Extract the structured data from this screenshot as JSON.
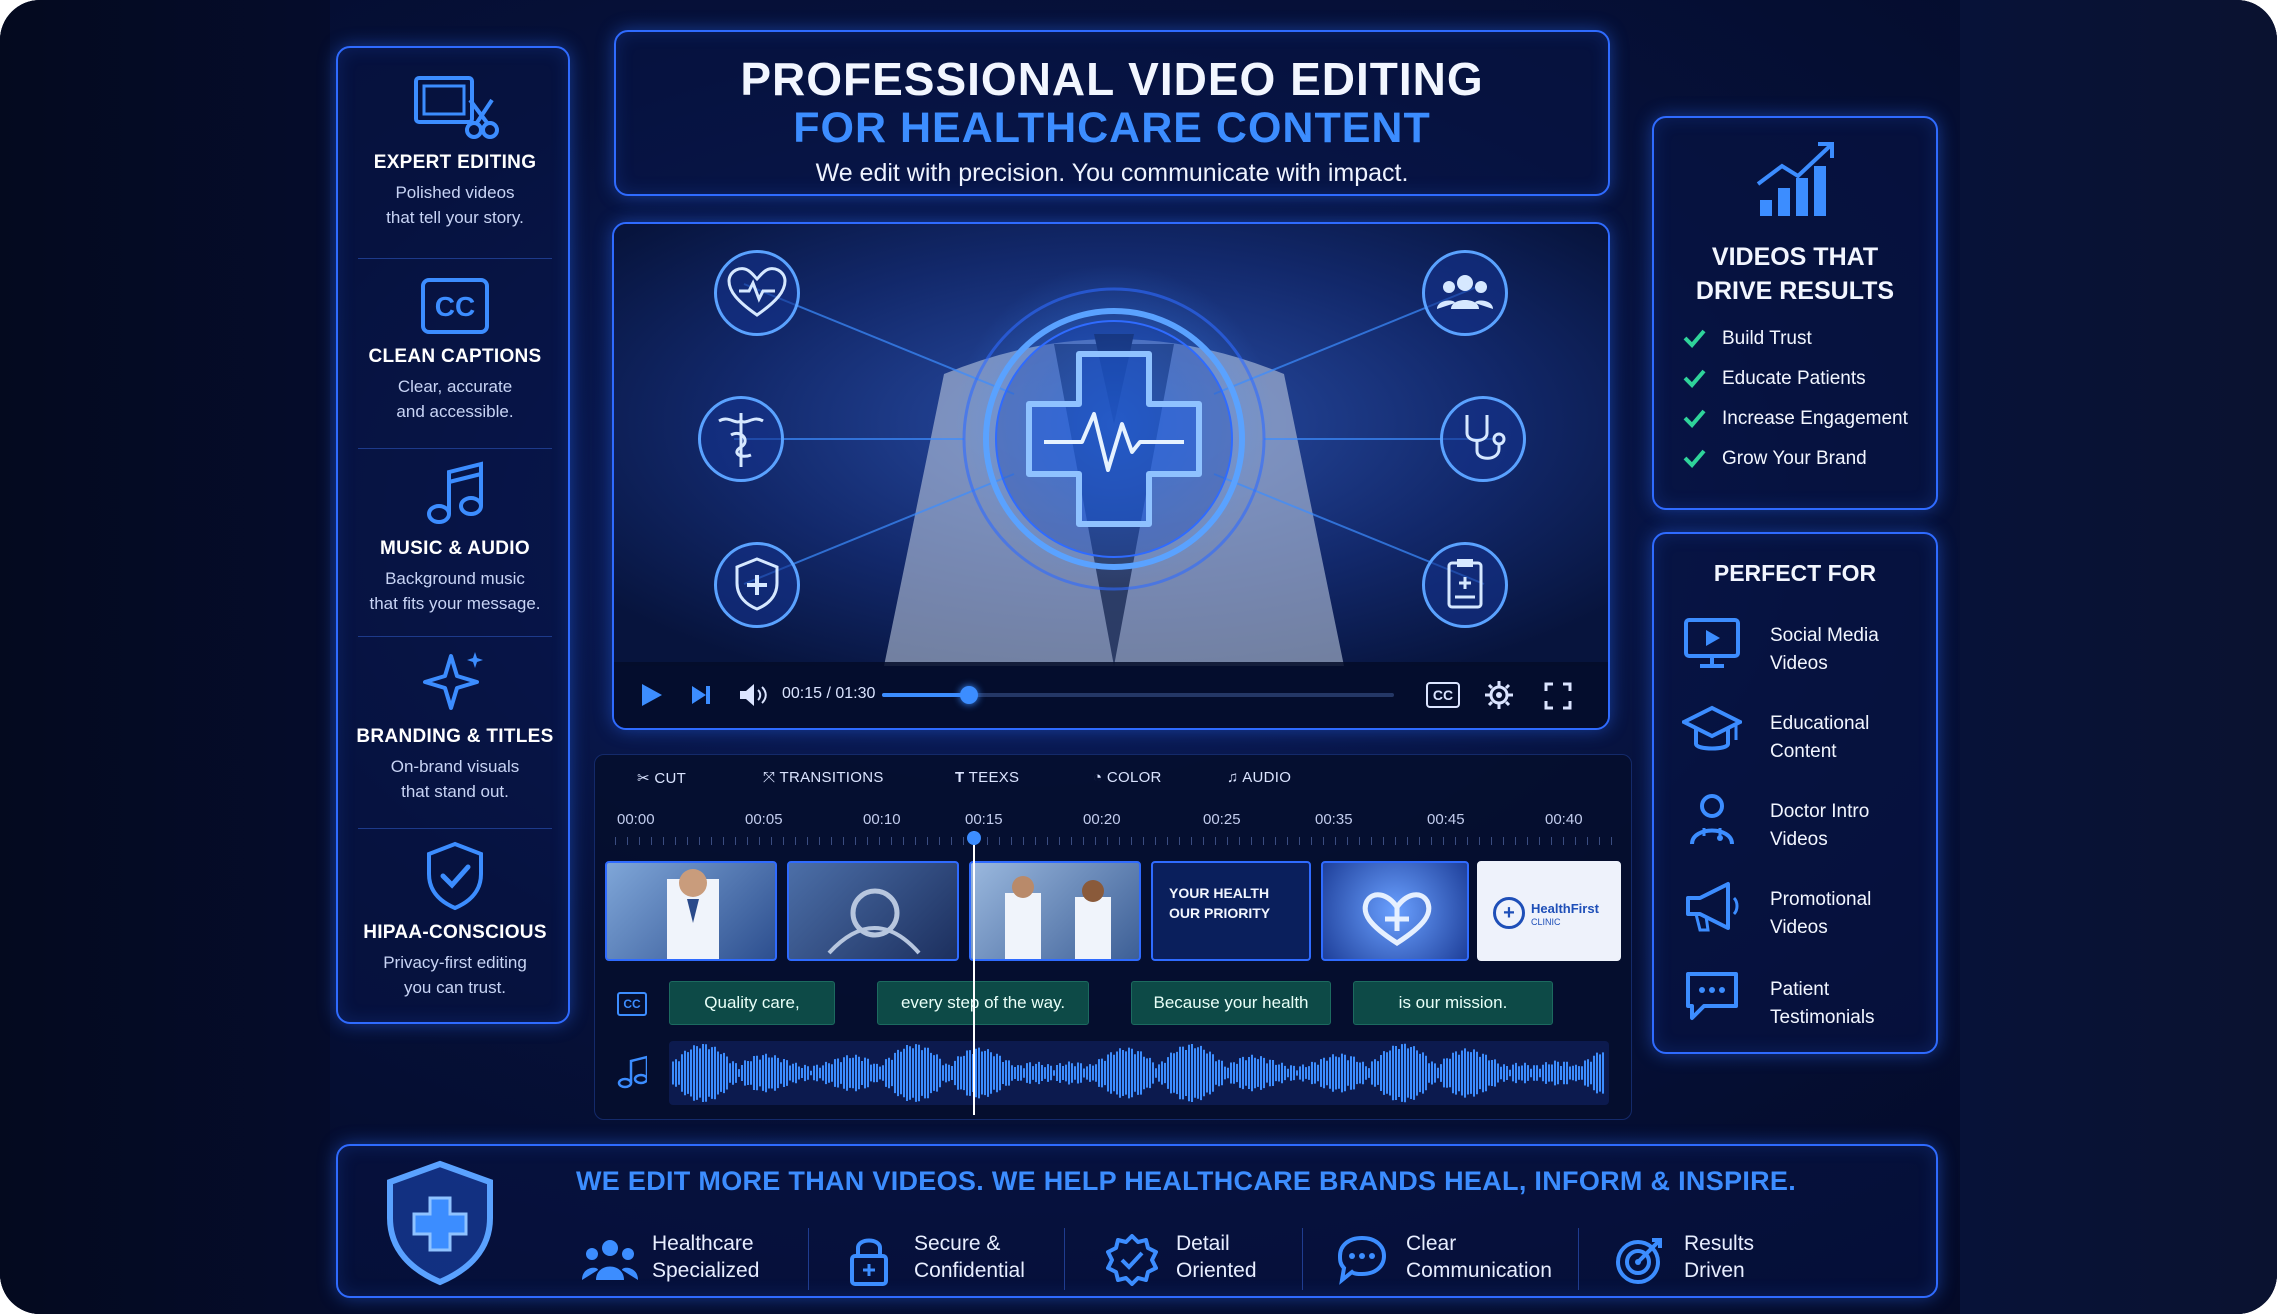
{
  "header": {
    "title_line1": "PROFESSIONAL VIDEO EDITING",
    "title_line2": "FOR HEALTHCARE CONTENT",
    "tagline": "We edit with precision. You communicate with impact."
  },
  "features": [
    {
      "icon": "film-scissors-icon",
      "title": "EXPERT EDITING",
      "line1": "Polished videos",
      "line2": "that tell your story."
    },
    {
      "icon": "cc-icon",
      "title": "CLEAN CAPTIONS",
      "line1": "Clear, accurate",
      "line2": "and accessible."
    },
    {
      "icon": "music-note-icon",
      "title": "MUSIC & AUDIO",
      "line1": "Background music",
      "line2": "that fits your message."
    },
    {
      "icon": "sparkle-icon",
      "title": "BRANDING & TITLES",
      "line1": "On-brand visuals",
      "line2": "that stand out."
    },
    {
      "icon": "shield-check-icon",
      "title": "HIPAA-CONSCIOUS",
      "line1": "Privacy-first editing",
      "line2": "you can trust."
    }
  ],
  "player": {
    "time": "00:15 / 01:30",
    "progress": 0.17,
    "cc_label": "CC",
    "hero_icon": "medical-cross-heartbeat-icon",
    "orbit_icons": [
      "heart-pulse-icon",
      "caduceus-icon",
      "shield-plus-icon",
      "people-icon",
      "stethoscope-icon",
      "clipboard-icon"
    ]
  },
  "editor": {
    "tools": [
      "CUT",
      "TRANSITIONS",
      "TEEXS",
      "COLOR",
      "AUDIO"
    ],
    "ticks": [
      "00:00",
      "00:05",
      "00:10",
      "00:15",
      "00:20",
      "00:25",
      "00:35",
      "00:45",
      "00:40"
    ],
    "clip_title_line1": "YOUR HEALTH",
    "clip_title_line2": "OUR PRIORITY",
    "brand_name": "HealthFirst",
    "brand_sub": "CLINIC",
    "cc_label": "CC",
    "captions": [
      "Quality care,",
      "every step of the way.",
      "Because your health",
      "is our mission."
    ]
  },
  "results": {
    "title_line1": "VIDEOS THAT",
    "title_line2": "DRIVE RESULTS",
    "items": [
      "Build Trust",
      "Educate Patients",
      "Increase Engagement",
      "Grow Your Brand"
    ]
  },
  "perfect_for": {
    "title": "PERFECT FOR",
    "items": [
      {
        "icon": "monitor-play-icon",
        "line1": "Social Media",
        "line2": "Videos"
      },
      {
        "icon": "graduation-cap-icon",
        "line1": "Educational",
        "line2": "Content"
      },
      {
        "icon": "doctor-icon",
        "line1": "Doctor Intro",
        "line2": "Videos"
      },
      {
        "icon": "megaphone-icon",
        "line1": "Promotional",
        "line2": "Videos"
      },
      {
        "icon": "chat-bubble-icon",
        "line1": "Patient",
        "line2": "Testimonials"
      }
    ]
  },
  "banner": {
    "headline": "WE EDIT MORE THAN VIDEOS. WE HELP HEALTHCARE BRANDS HEAL, INFORM & INSPIRE.",
    "items": [
      {
        "icon": "team-icon",
        "line1": "Healthcare",
        "line2": "Specialized"
      },
      {
        "icon": "lock-icon",
        "line1": "Secure &",
        "line2": "Confidential"
      },
      {
        "icon": "badge-check-icon",
        "line1": "Detail",
        "line2": "Oriented"
      },
      {
        "icon": "chat-icon",
        "line1": "Clear",
        "line2": "Communication"
      },
      {
        "icon": "target-icon",
        "line1": "Results",
        "line2": "Driven"
      }
    ]
  },
  "colors": {
    "accent": "#2f6bff",
    "highlight": "#3c8dff",
    "check": "#2fd39a",
    "caption_bg": "#0d4a47",
    "bg": "#050b26"
  }
}
